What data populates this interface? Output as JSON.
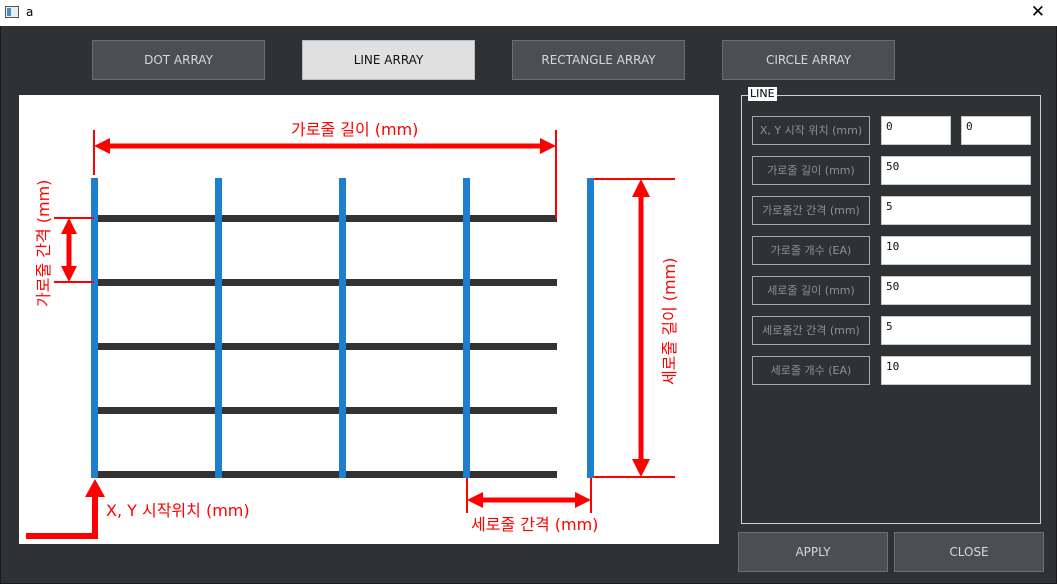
{
  "window": {
    "title": "a",
    "close_symbol": "✕"
  },
  "modes": [
    {
      "label": "DOT ARRAY",
      "active": false
    },
    {
      "label": "LINE ARRAY",
      "active": true
    },
    {
      "label": "RECTANGLE ARRAY",
      "active": false
    },
    {
      "label": "CIRCLE ARRAY",
      "active": false
    }
  ],
  "diagram": {
    "h_length": "가로줄 길이 (mm)",
    "h_spacing": "가로줄 간격 (mm)",
    "v_length": "세로줄 길이 (mm)",
    "v_spacing": "세로줄 간격 (mm)",
    "origin": "X, Y 시작위치 (mm)"
  },
  "panel": {
    "legend": "LINE",
    "fields": [
      {
        "label": "X, Y 시작 위치 (mm)",
        "values": [
          "0",
          "0"
        ]
      },
      {
        "label": "가로줄 길이 (mm)",
        "values": [
          "50"
        ]
      },
      {
        "label": "가로줄간 간격 (mm)",
        "values": [
          "5"
        ]
      },
      {
        "label": "가로줄 개수 (EA)",
        "values": [
          "10"
        ]
      },
      {
        "label": "세로줄 길이 (mm)",
        "values": [
          "50"
        ]
      },
      {
        "label": "세로줄간 간격 (mm)",
        "values": [
          "5"
        ]
      },
      {
        "label": "세로줄 개수 (EA)",
        "values": [
          "10"
        ]
      }
    ]
  },
  "actions": {
    "apply": "APPLY",
    "close": "CLOSE"
  },
  "colors": {
    "background": "#2f3234",
    "annotation": "#ff0000",
    "vertical_line": "#1e7fcf",
    "horizontal_line": "#333333"
  }
}
